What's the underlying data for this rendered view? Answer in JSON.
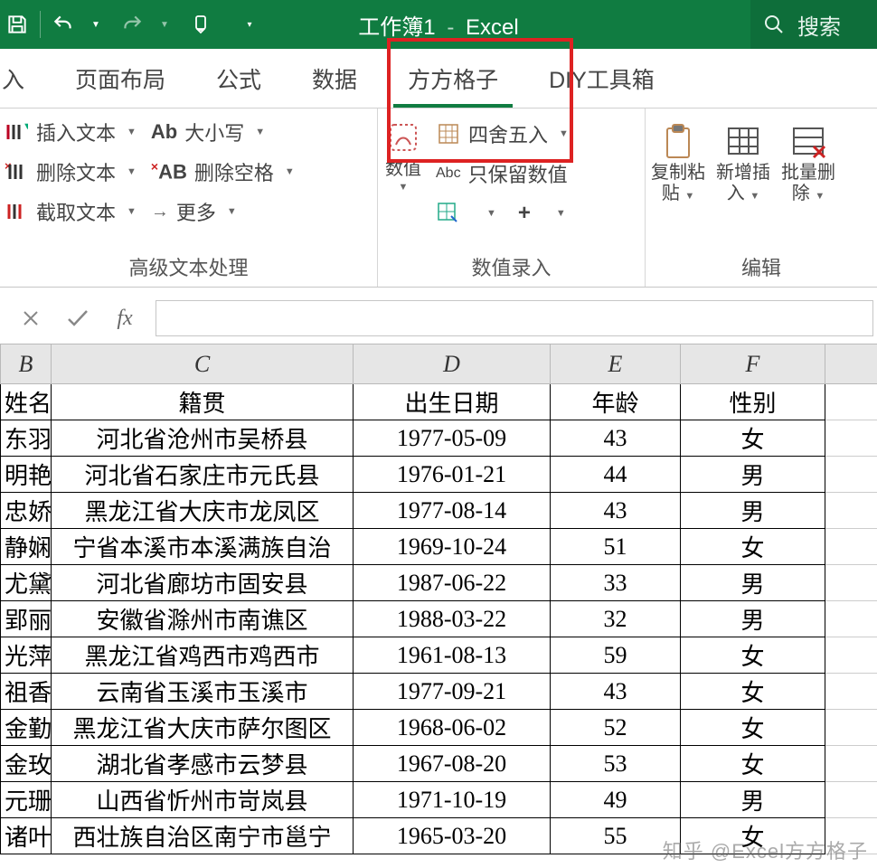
{
  "titlebar": {
    "workbook": "工作簿1",
    "dash": "-",
    "app": "Excel",
    "search_placeholder": "搜索"
  },
  "tabs": {
    "insert": "入",
    "layout": "页面布局",
    "formula": "公式",
    "data": "数据",
    "ffgz": "方方格子",
    "diy": "DIY工具箱"
  },
  "ribbon": {
    "group1": {
      "insert_text": "插入文本",
      "delete_text": "删除文本",
      "cut_text": "截取文本",
      "case": "大小写",
      "delete_space": "删除空格",
      "more": "更多",
      "label": "高级文本处理",
      "ab": "Ab",
      "xab": "AB",
      "arrow": "→"
    },
    "group2": {
      "numeric": "数值",
      "round": "四舍五入",
      "keep_num": "只保留数值",
      "abc": "Abc",
      "plus": "+",
      "label": "数值录入"
    },
    "group3": {
      "copy": "复制粘",
      "copy2": "贴",
      "insert": "新增插",
      "insert2": "入",
      "batchdel": "批量删",
      "batchdel2": "除",
      "label": "编辑"
    }
  },
  "fbar": {
    "fx": "fx"
  },
  "columns": {
    "B": "B",
    "C": "C",
    "D": "D",
    "E": "E",
    "F": "F"
  },
  "headers": {
    "name": "姓名",
    "origin": "籍贯",
    "dob": "出生日期",
    "age": "年龄",
    "sex": "性别"
  },
  "rows": [
    {
      "name": "东羽",
      "origin": "河北省沧州市吴桥县",
      "dob": "1977-05-09",
      "age": "43",
      "sex": "女"
    },
    {
      "name": "明艳",
      "origin": "河北省石家庄市元氏县",
      "dob": "1976-01-21",
      "age": "44",
      "sex": "男"
    },
    {
      "name": "忠娇",
      "origin": "黑龙江省大庆市龙凤区",
      "dob": "1977-08-14",
      "age": "43",
      "sex": "男"
    },
    {
      "name": "静娴",
      "origin": "宁省本溪市本溪满族自治",
      "dob": "1969-10-24",
      "age": "51",
      "sex": "女"
    },
    {
      "name": "尤黛",
      "origin": "河北省廊坊市固安县",
      "dob": "1987-06-22",
      "age": "33",
      "sex": "男"
    },
    {
      "name": "郢丽",
      "origin": "安徽省滁州市南谯区",
      "dob": "1988-03-22",
      "age": "32",
      "sex": "男"
    },
    {
      "name": "光萍",
      "origin": "黑龙江省鸡西市鸡西市",
      "dob": "1961-08-13",
      "age": "59",
      "sex": "女"
    },
    {
      "name": "祖香",
      "origin": "云南省玉溪市玉溪市",
      "dob": "1977-09-21",
      "age": "43",
      "sex": "女"
    },
    {
      "name": "金勤",
      "origin": "黑龙江省大庆市萨尔图区",
      "dob": "1968-06-02",
      "age": "52",
      "sex": "女"
    },
    {
      "name": "金玫",
      "origin": "湖北省孝感市云梦县",
      "dob": "1967-08-20",
      "age": "53",
      "sex": "女"
    },
    {
      "name": "元珊",
      "origin": "山西省忻州市岢岚县",
      "dob": "1971-10-19",
      "age": "49",
      "sex": "男"
    },
    {
      "name": "诸叶",
      "origin": "西壮族自治区南宁市邕宁",
      "dob": "1965-03-20",
      "age": "55",
      "sex": "女"
    }
  ],
  "watermark": "知乎 @Excel方方格子"
}
